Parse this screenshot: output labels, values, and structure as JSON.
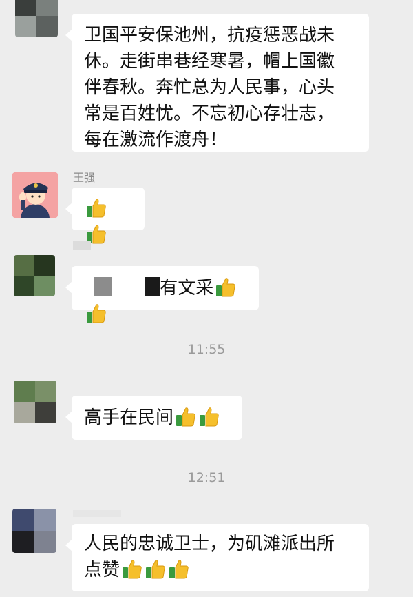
{
  "messages": [
    {
      "text_lines": [
        "卫国平安保池州，抗疫惩恶战未",
        "休。走街串巷经寒暑，帽上国徽",
        "伴春秋。奔忙总为人民事，心头",
        "常是百姓忧。不忘初心存壮志，",
        "每在激流作渡舟！"
      ]
    },
    {
      "sender": "王强",
      "emoji": "👍👍"
    },
    {
      "text": "有文采",
      "emoji": "👍👍"
    },
    {
      "text": "高手在民间",
      "emoji": "👍👍"
    },
    {
      "text_lines": [
        "人民的忠诚卫士，为矶滩派出所",
        "点赞"
      ],
      "emoji": "👍👍👍"
    }
  ],
  "timestamps": [
    "11:55",
    "12:51"
  ],
  "colors": {
    "background": "#ededed",
    "bubble": "#ffffff",
    "timestamp": "#9a9a9a",
    "sender_name": "#8a8a8a"
  },
  "icons": [
    "thumbs-up-icon",
    "police-avatar-icon"
  ]
}
